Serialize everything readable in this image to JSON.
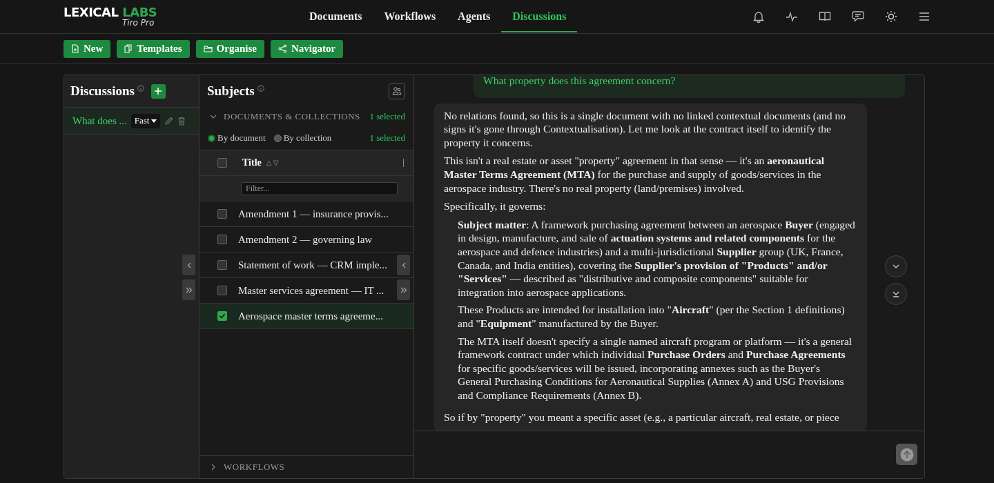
{
  "header": {
    "logo": {
      "primary": "LEXICAL",
      "accent": "LABS",
      "sub": "Tiro Pro"
    },
    "nav": [
      {
        "label": "Documents",
        "selected": false
      },
      {
        "label": "Workflows",
        "selected": false
      },
      {
        "label": "Agents",
        "selected": false
      },
      {
        "label": "Discussions",
        "selected": true
      }
    ]
  },
  "toolbar": [
    "New",
    "Templates",
    "Organise",
    "Navigator"
  ],
  "discussions": {
    "title": "Discussions",
    "items": [
      {
        "text": "What does ...",
        "mode": "Fast",
        "selected": true
      }
    ]
  },
  "subjects": {
    "title": "Subjects",
    "section": {
      "label": "DOCUMENTS & COLLECTIONS",
      "expanded": true,
      "count": "1 selected"
    },
    "view_options": [
      {
        "label": "By document",
        "selected": true
      },
      {
        "label": "By collection",
        "selected": false
      }
    ],
    "view_count": "1 selected",
    "table": {
      "column": "Title",
      "all_checked": false,
      "filter_placeholder": "Filter...",
      "rows": [
        {
          "title": "Amendment 1 — insurance provis...",
          "checked": false
        },
        {
          "title": "Amendment 2 — governing law",
          "checked": false
        },
        {
          "title": "Statement of work — CRM imple...",
          "checked": false
        },
        {
          "title": "Master services agreement — IT ...",
          "checked": false
        },
        {
          "title": "Aerospace master terms agreeme...",
          "checked": true
        }
      ]
    },
    "workflows": {
      "label": "WORKFLOWS",
      "expanded": false
    }
  },
  "chat": {
    "messages": [
      {
        "kind": "user",
        "blocks": [
          {
            "kind": "p",
            "text": "What property does this agreement concern?"
          }
        ]
      },
      {
        "kind": "assistant",
        "blocks": [
          {
            "kind": "p",
            "text": "No relations found, so this is a single document with no linked contextual documents (and no signs it's gone through Contextualisation). Let me look at the contract itself to identify the property it concerns."
          },
          {
            "kind": "p",
            "text": "This isn't a real estate or asset \"property\" agreement in that sense — it's an **aeronautical Master Terms Agreement (MTA)** for the purchase and supply of goods/services in the aerospace industry. There's no real property (land/premises) involved."
          },
          {
            "kind": "p",
            "text": "Specifically, it governs:"
          },
          {
            "kind": "indent",
            "text": "**Subject matter**: A framework purchasing agreement between an aerospace **Buyer** (engaged in design, manufacture, and sale of **actuation systems and related components** for the aerospace and defence industries) and a multi-jurisdictional **Supplier** group (UK, France, Canada, and India entities), covering the **Supplier's provision of \"Products\" and/or \"Services\"** — described as \"distributive and composite components\" suitable for integration into aerospace applications."
          },
          {
            "kind": "indent",
            "text": "These Products are intended for installation into \"**Aircraft**\" (per the Section 1 definitions) and \"**Equipment**\" manufactured by the Buyer."
          },
          {
            "kind": "indent",
            "text": "The MTA itself doesn't specify a single named aircraft program or platform — it's a general framework contract under which individual **Purchase Orders** and **Purchase Agreements** for specific goods/services will be issued, incorporating annexes such as the Buyer's General Purchasing Conditions for Aeronautical Supplies (Annex A) and USG Provisions and Compliance Requirements (Annex B)."
          },
          {
            "kind": "p",
            "text": "So if by \"property\" you meant a specific asset (e.g., a particular aircraft, real estate, or piece"
          }
        ]
      }
    ]
  }
}
